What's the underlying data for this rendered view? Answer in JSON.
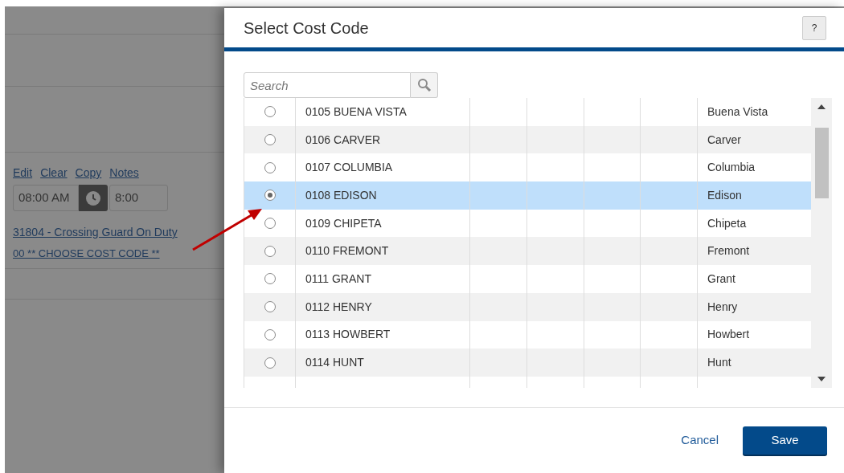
{
  "background_page": {
    "links": [
      "Edit",
      "Clear",
      "Copy",
      "Notes"
    ],
    "start_time": "08:00 AM",
    "hours": "8:00",
    "job_link": "31804 - Crossing Guard On Duty",
    "cost_code_link": "00 ** CHOOSE COST CODE **"
  },
  "dialog": {
    "title": "Select Cost Code",
    "help_button": "?",
    "search": {
      "placeholder": "Search"
    },
    "rows": [
      {
        "code": "0105 BUENA VISTA",
        "name": "Buena Vista",
        "selected": false
      },
      {
        "code": "0106 CARVER",
        "name": "Carver",
        "selected": false
      },
      {
        "code": "0107 COLUMBIA",
        "name": "Columbia",
        "selected": false
      },
      {
        "code": "0108 EDISON",
        "name": "Edison",
        "selected": true
      },
      {
        "code": "0109 CHIPETA",
        "name": "Chipeta",
        "selected": false
      },
      {
        "code": "0110 FREMONT",
        "name": "Fremont",
        "selected": false
      },
      {
        "code": "0111 GRANT",
        "name": "Grant",
        "selected": false
      },
      {
        "code": "0112 HENRY",
        "name": "Henry",
        "selected": false
      },
      {
        "code": "0113 HOWBERT",
        "name": "Howbert",
        "selected": false
      },
      {
        "code": "0114 HUNT",
        "name": "Hunt",
        "selected": false
      }
    ],
    "buttons": [
      {
        "label": "Cancel",
        "kind": "link"
      },
      {
        "label": "Save",
        "kind": "primary"
      }
    ]
  }
}
